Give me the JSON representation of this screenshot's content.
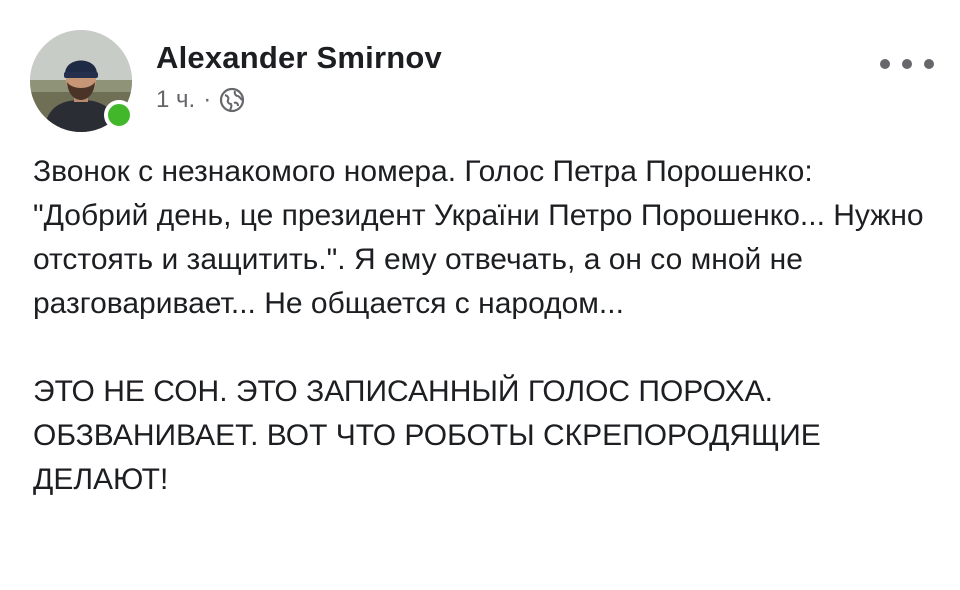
{
  "post": {
    "author": "Alexander Smirnov",
    "time": "1 ч.",
    "separator": "·",
    "privacy_icon": "globe-icon",
    "more_icon": "more-options-icon",
    "paragraphs": [
      "Звонок с незнакомого номера. Голос Петра Порошенко: \"Добрий день, це президент України Петро Порошенко... Нужно отстоять и защитить.\". Я ему отвечать, а он со мной не разговаривает... Не общается с народом...",
      "ЭТО НЕ СОН. ЭТО ЗАПИСАННЫЙ ГОЛОС ПОРОХА. ОБЗВАНИВАЕТ. ВОТ ЧТО РОБОТЫ СКРЕПОРОДЯЩИЕ ДЕЛАЮТ!"
    ]
  },
  "colors": {
    "online": "#42b72a",
    "meta_text": "#65676b",
    "body_text": "#1c1e21"
  }
}
